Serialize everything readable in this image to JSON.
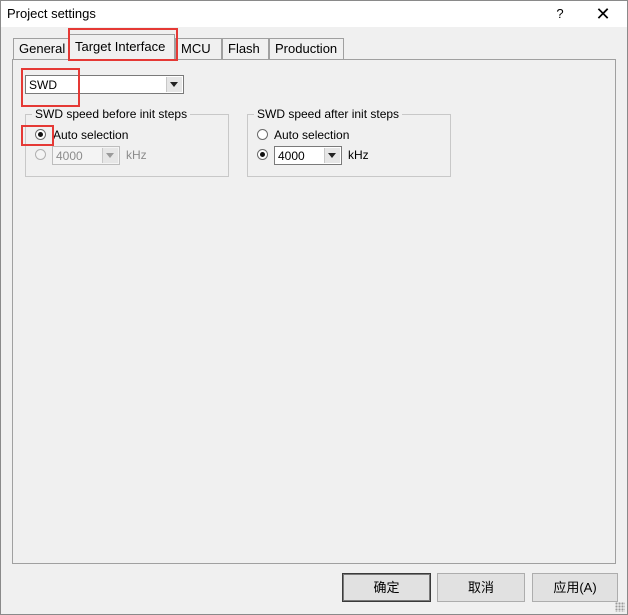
{
  "window": {
    "title": "Project settings",
    "help_label": "?",
    "close_label": "✕"
  },
  "tabs": [
    {
      "label": "General"
    },
    {
      "label": "Target Interface",
      "selected": true
    },
    {
      "label": "MCU"
    },
    {
      "label": "Flash"
    },
    {
      "label": "Production"
    }
  ],
  "interface_select": {
    "value": "SWD"
  },
  "group_before": {
    "title": "SWD speed before init steps",
    "auto_label": "Auto selection",
    "auto_selected": true,
    "speed_value": "4000",
    "speed_unit": "kHz",
    "speed_enabled": false
  },
  "group_after": {
    "title": "SWD speed after init steps",
    "auto_label": "Auto selection",
    "auto_selected": false,
    "speed_value": "4000",
    "speed_unit": "kHz",
    "speed_enabled": true
  },
  "buttons": {
    "ok": "确定",
    "cancel": "取消",
    "apply": "应用(A)"
  },
  "highlight_color": "#e53935"
}
